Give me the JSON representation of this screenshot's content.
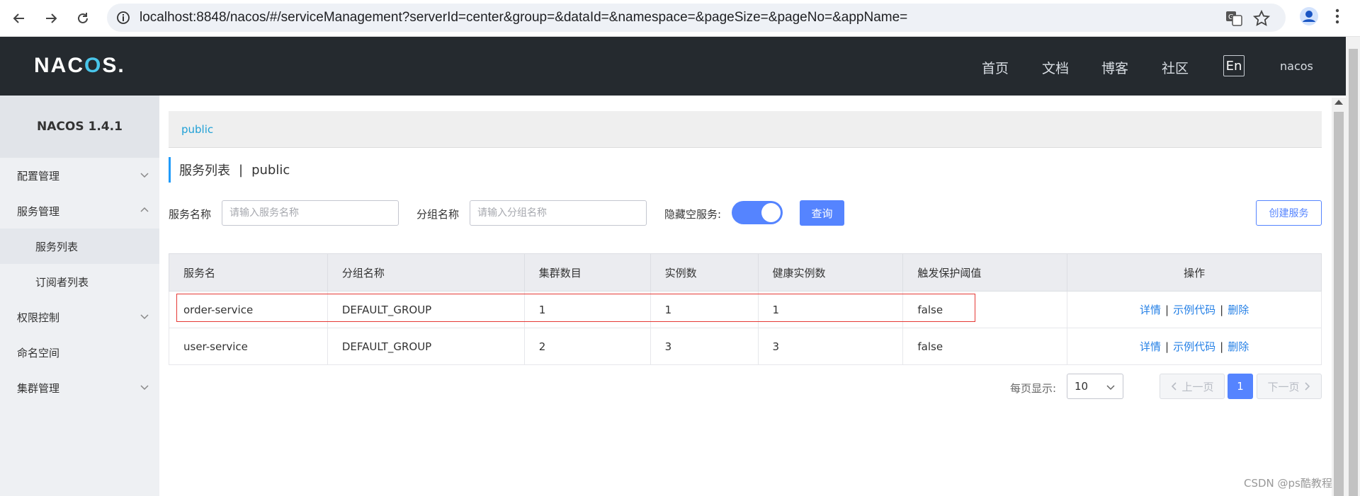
{
  "browser": {
    "url": "localhost:8848/nacos/#/serviceManagement?serverId=center&group=&dataId=&namespace=&pageSize=&pageNo=&appName="
  },
  "header": {
    "logo_pre": "NA",
    "logo_c": "C",
    "logo_o": "O",
    "logo_post": "S.",
    "nav": [
      "首页",
      "文档",
      "博客",
      "社区"
    ],
    "lang": "En",
    "user": "nacos"
  },
  "sidebar": {
    "version": "NACOS 1.4.1",
    "items": [
      {
        "label": "配置管理"
      },
      {
        "label": "服务管理"
      },
      {
        "label": "服务列表"
      },
      {
        "label": "订阅者列表"
      },
      {
        "label": "权限控制"
      },
      {
        "label": "命名空间"
      },
      {
        "label": "集群管理"
      }
    ]
  },
  "main": {
    "namespace": "public",
    "title": "服务列表",
    "title_sep": "|",
    "title_ns": "public",
    "filters": {
      "service_label": "服务名称",
      "service_placeholder": "请输入服务名称",
      "group_label": "分组名称",
      "group_placeholder": "请输入分组名称",
      "hide_empty_label": "隐藏空服务:",
      "hide_empty_on": true,
      "search_button": "查询",
      "create_button": "创建服务"
    },
    "table": {
      "columns": [
        "服务名",
        "分组名称",
        "集群数目",
        "实例数",
        "健康实例数",
        "触发保护阈值",
        "操作"
      ],
      "rows": [
        {
          "name": "order-service",
          "group": "DEFAULT_GROUP",
          "clusters": "1",
          "instances": "1",
          "healthy": "1",
          "threshold": "false"
        },
        {
          "name": "user-service",
          "group": "DEFAULT_GROUP",
          "clusters": "2",
          "instances": "3",
          "healthy": "3",
          "threshold": "false"
        }
      ],
      "actions": {
        "detail": "详情",
        "sample": "示例代码",
        "delete": "删除",
        "sep": "|"
      }
    },
    "pagination": {
      "per_page_label": "每页显示:",
      "per_page_value": "10",
      "prev": "上一页",
      "current": "1",
      "next": "下一页"
    }
  },
  "watermark": "CSDN @ps酷教程",
  "colors": {
    "primary": "#5584ff",
    "header_bg": "#252a2f",
    "highlight": "#e53935"
  }
}
